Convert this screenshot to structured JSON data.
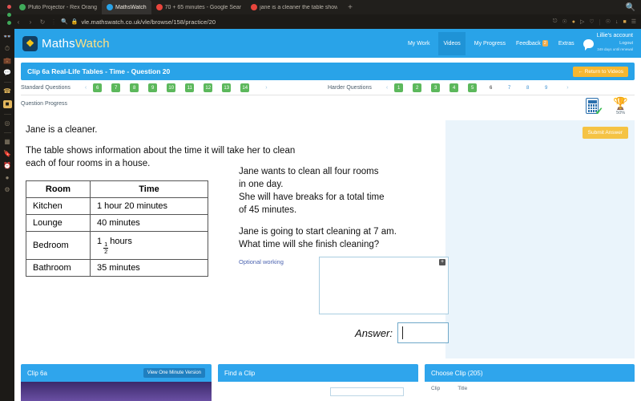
{
  "browser": {
    "tabs": [
      {
        "title": "Pluto Projector - Rex Orang",
        "favicon_color": "#3faa5a",
        "active": false
      },
      {
        "title": "MathsWatch",
        "favicon_color": "#29a3e8",
        "active": true
      },
      {
        "title": "70 + 65 minutes - Google Sear",
        "favicon_color": "#e8453c",
        "active": false
      },
      {
        "title": "jane is a cleaner the table show",
        "favicon_color": "#e8453c",
        "active": false
      }
    ],
    "new_tab_label": "+",
    "nav": {
      "back": "‹",
      "forward": "›",
      "reload": "↻",
      "menu": "⋮"
    },
    "security_icon": "lock-icon",
    "url": "vle.mathswatch.co.uk/vle/browse/158/practice/20",
    "right_icons": [
      "extension-icon",
      "shield-icon",
      "adblock-icon",
      "send-icon",
      "heart-icon",
      "settings-icon",
      "download-icon",
      "battery-icon",
      "menu-icon"
    ],
    "search_icon": "search-icon"
  },
  "sidepanel": {
    "items": [
      {
        "icon": "glasses-icon"
      },
      {
        "icon": "clock-dashboard-icon"
      },
      {
        "icon": "briefcase-icon"
      },
      {
        "icon": "notes-icon"
      },
      {
        "icon": "whatsapp-icon"
      },
      {
        "icon": "window-icon"
      },
      {
        "icon": "target-icon"
      },
      {
        "icon": "grid-icon"
      },
      {
        "icon": "bookmark-icon"
      },
      {
        "icon": "history-icon"
      },
      {
        "icon": "download-panel-icon"
      },
      {
        "icon": "gear-icon"
      }
    ]
  },
  "header": {
    "brand_logo": "mathswatch-logo",
    "brand_first": "Maths",
    "brand_second": "Watch",
    "nav_items": [
      {
        "label": "My Work",
        "active": false
      },
      {
        "label": "Videos",
        "active": true
      },
      {
        "label": "My Progress",
        "active": false
      },
      {
        "label": "Feedback",
        "active": false,
        "badge": "2"
      },
      {
        "label": "Extras",
        "active": false
      }
    ],
    "account": {
      "name": "Lillie's account",
      "logout": "Logout",
      "renewal": "349 days until renewal"
    }
  },
  "clip_bar": {
    "title": "Clip 6a Real-Life Tables - Time - Question 20",
    "return_button": "← Return to Videos"
  },
  "question_nav": {
    "standard_label": "Standard Questions",
    "standard_prev": "‹",
    "standard_items": [
      "6",
      "7",
      "8",
      "9",
      "10",
      "11",
      "12",
      "13",
      "14"
    ],
    "standard_next": "›",
    "harder_label": "Harder Questions",
    "harder_prev": "‹",
    "harder_green": [
      "1",
      "2",
      "3",
      "4",
      "5"
    ],
    "harder_current": "6",
    "harder_links": [
      "7",
      "8",
      "9"
    ],
    "harder_next": "›"
  },
  "progress": {
    "label": "Question Progress",
    "calculator_icon": "calculator-allowed-icon",
    "trophy_icon": "trophy-icon",
    "percent": "50%"
  },
  "question": {
    "line1": "Jane is a cleaner.",
    "line2": "The table shows information about the time it will take her to clean",
    "line3": "each of four rooms in a house.",
    "table": {
      "headers": [
        "Room",
        "Time"
      ],
      "rows": [
        {
          "room": "Kitchen",
          "time": "1 hour 20 minutes",
          "fraction": false
        },
        {
          "room": "Lounge",
          "time": "40 minutes",
          "fraction": false
        },
        {
          "room": "Bedroom",
          "time_prefix": "1",
          "time_num": "1",
          "time_den": "2",
          "time_suffix": "hours",
          "fraction": true
        },
        {
          "room": "Bathroom",
          "time": "35 minutes",
          "fraction": false
        }
      ]
    },
    "right_p1_l1": "Jane wants to clean all four rooms",
    "right_p1_l2": "in one day.",
    "right_p1_l3": "She will have breaks for a total time",
    "right_p1_l4": "of 45 minutes.",
    "right_p2_l1": "Jane is going to start cleaning at 7 am.",
    "right_p2_l2": "What time will she finish cleaning?",
    "working_label": "Optional working",
    "working_value": "",
    "add_working_button": "+",
    "answer_label": "Answer:",
    "answer_value": "",
    "submit_button": "Submit Answer"
  },
  "bottom": {
    "clip_panel": {
      "title": "Clip 6a",
      "one_minute_button": "View One Minute Version"
    },
    "find_panel": {
      "title": "Find a Clip",
      "search_value": ""
    },
    "choose_panel": {
      "title": "Choose Clip (205)",
      "columns": [
        "Clip",
        "Title"
      ]
    }
  },
  "colors": {
    "brand_blue": "#29a3e8",
    "accent_yellow": "#f5b731",
    "green": "#5cb85c",
    "panel_blue": "#eaf4fb"
  }
}
